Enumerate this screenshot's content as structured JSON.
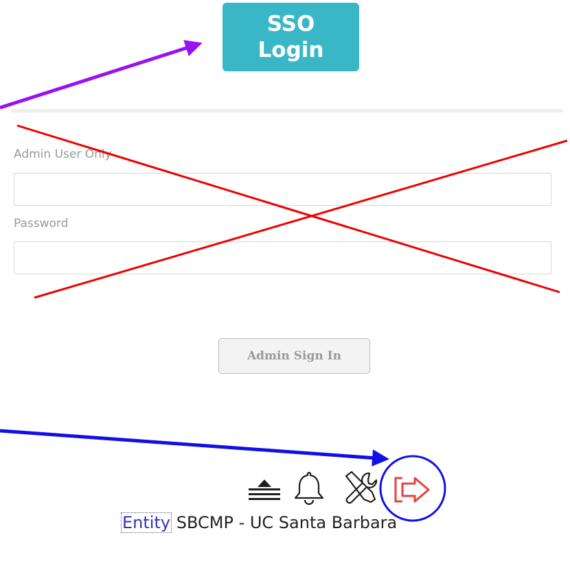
{
  "sso": {
    "line1": "SSO",
    "line2": "Login"
  },
  "form": {
    "username_label": "Admin User Only",
    "password_label": "Password",
    "username_value": "",
    "password_value": "",
    "submit_label": "Admin Sign In"
  },
  "toolbar": {
    "icons": [
      "eject-icon",
      "bell-icon",
      "tools-icon",
      "sign-out-icon"
    ]
  },
  "entity": {
    "label": "Entity",
    "value": "SBCMP - UC Santa Barbara"
  },
  "colors": {
    "sso_button": "#3ab7c6",
    "cross_out": "#ee0000",
    "arrow_purple": "#9a10f0",
    "arrow_blue": "#1010e6",
    "sign_out_red": "#e84040"
  }
}
